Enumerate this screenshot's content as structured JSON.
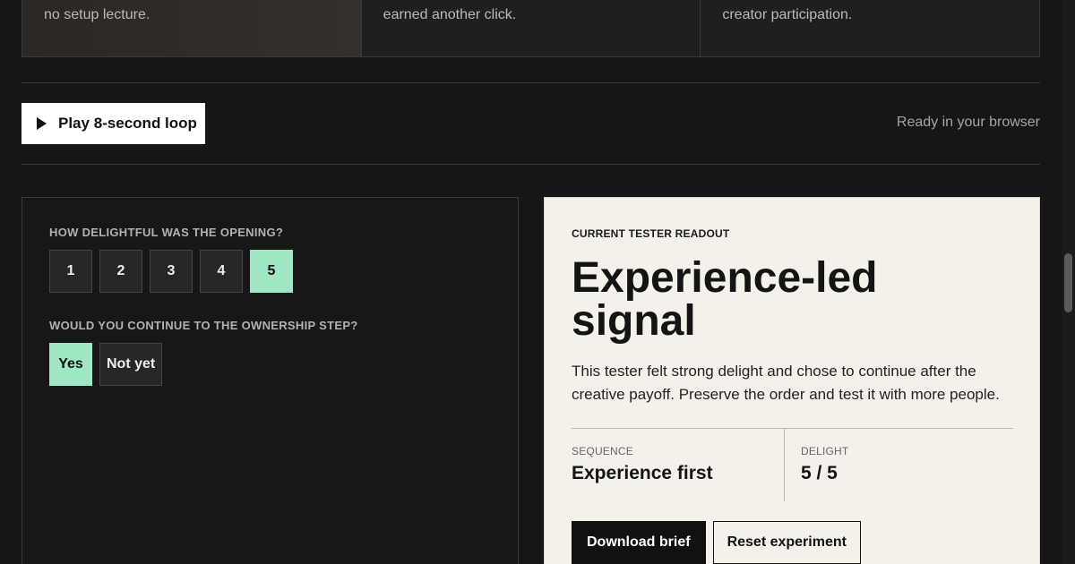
{
  "cards": [
    {
      "text": "no setup lecture."
    },
    {
      "text": "earned another click."
    },
    {
      "text": "creator participation."
    }
  ],
  "toolbar": {
    "play_label": "Play 8-second loop",
    "status": "Ready in your browser"
  },
  "survey": {
    "delight_question": "HOW DELIGHTFUL WAS THE OPENING?",
    "ratings": [
      "1",
      "2",
      "3",
      "4",
      "5"
    ],
    "selected_rating": "5",
    "continue_question": "WOULD YOU CONTINUE TO THE OWNERSHIP STEP?",
    "yes_label": "Yes",
    "no_label": "Not yet",
    "selected_continue": "Yes"
  },
  "readout": {
    "label": "CURRENT TESTER READOUT",
    "title": "Experience-led signal",
    "description": "This tester felt strong delight and chose to continue after the creative payoff. Preserve the order and test it with more people.",
    "sequence_label": "SEQUENCE",
    "sequence_value": "Experience first",
    "delight_label": "DELIGHT",
    "delight_value": "5 / 5",
    "download_label": "Download brief",
    "reset_label": "Reset experiment"
  },
  "colors": {
    "accent": "#9fe6c2",
    "background": "#161616",
    "readout_bg": "#f4f1ea"
  }
}
